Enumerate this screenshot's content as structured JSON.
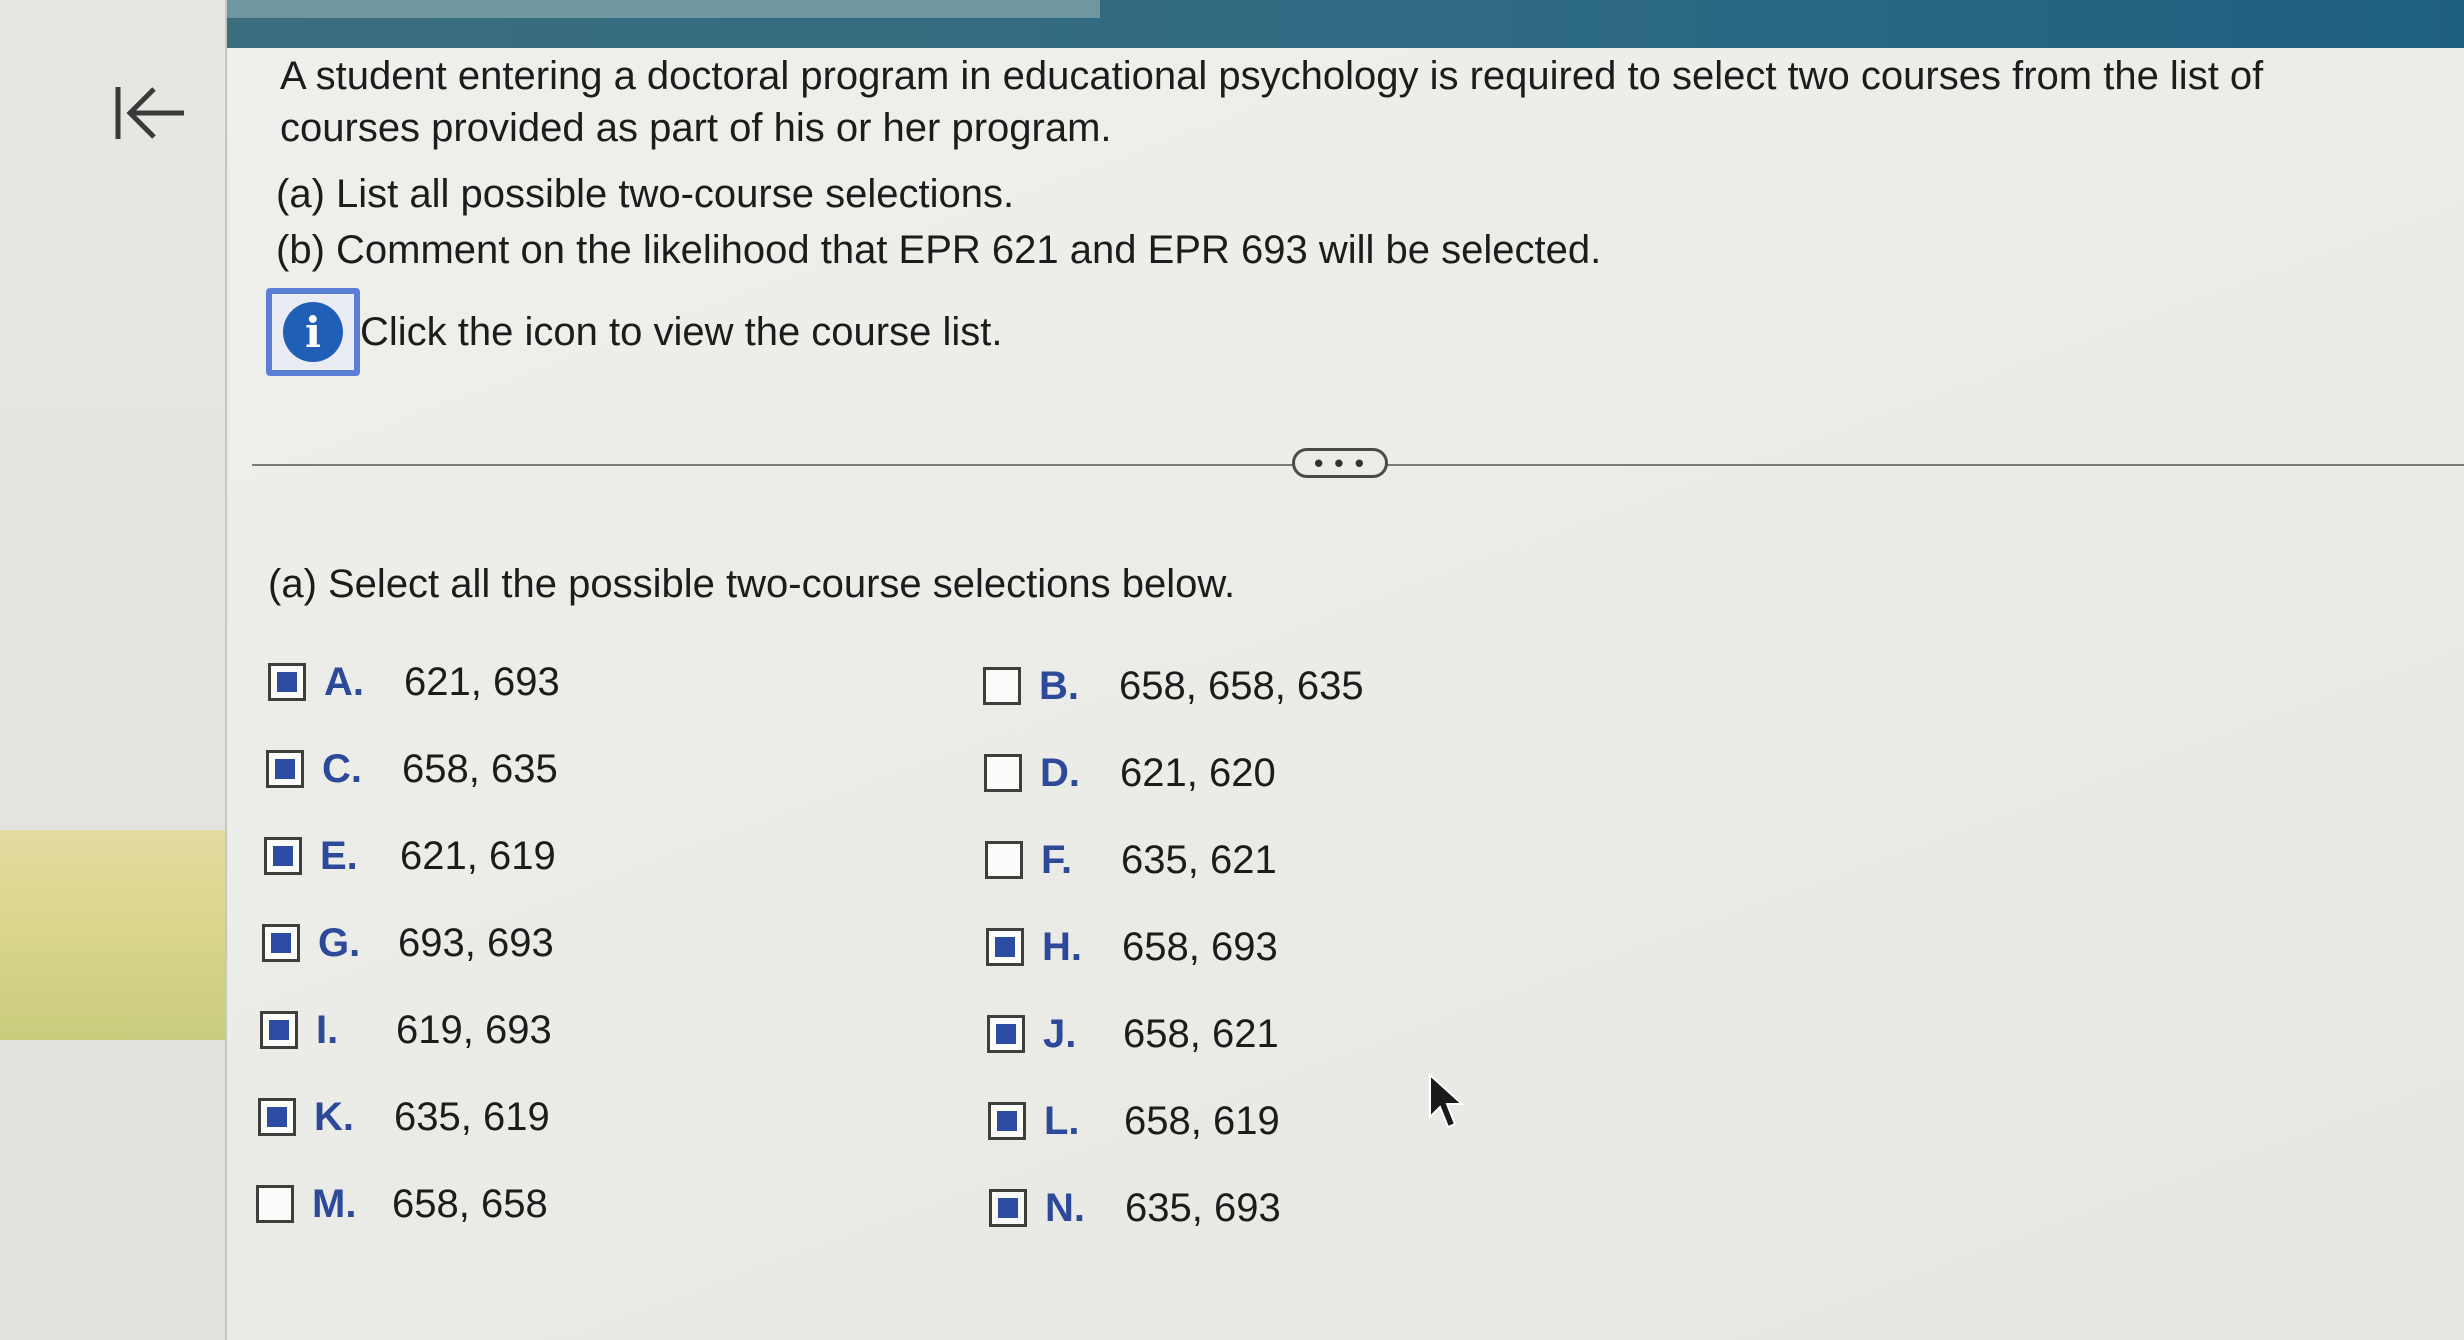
{
  "nav": {
    "back_icon": "arrow-left-to-line-icon"
  },
  "problem": {
    "intro": "A student entering a doctoral program in educational psychology is required to select two courses from the list of courses provided as part of his or her program.",
    "part_a": "(a) List all possible two-course selections.",
    "part_b": "(b) Comment on the likelihood that EPR 621 and EPR 693 will be selected.",
    "info_icon": "info-icon",
    "info_glyph": "i",
    "info_text": "Click the icon to view the course list."
  },
  "divider": {
    "more_label": "• • •"
  },
  "question": {
    "text": "(a) Select all the possible two-course selections below.",
    "options": [
      {
        "letter": "A.",
        "value": "621, 693",
        "checked": true
      },
      {
        "letter": "B.",
        "value": "658, 658, 635",
        "checked": false
      },
      {
        "letter": "C.",
        "value": "658, 635",
        "checked": true
      },
      {
        "letter": "D.",
        "value": "621, 620",
        "checked": false
      },
      {
        "letter": "E.",
        "value": "621, 619",
        "checked": true
      },
      {
        "letter": "F.",
        "value": "635, 621",
        "checked": false
      },
      {
        "letter": "G.",
        "value": "693, 693",
        "checked": true
      },
      {
        "letter": "H.",
        "value": "658, 693",
        "checked": true
      },
      {
        "letter": "I.",
        "value": "619, 693",
        "checked": true
      },
      {
        "letter": "J.",
        "value": "658, 621",
        "checked": true
      },
      {
        "letter": "K.",
        "value": "635, 619",
        "checked": true
      },
      {
        "letter": "L.",
        "value": "658, 619",
        "checked": true
      },
      {
        "letter": "M.",
        "value": "658, 658",
        "checked": false
      },
      {
        "letter": "N.",
        "value": "635, 693",
        "checked": true
      }
    ]
  },
  "colors": {
    "accent": "#2d4a9a",
    "info_blue": "#1f5fb8",
    "header": "#2e6a82"
  }
}
